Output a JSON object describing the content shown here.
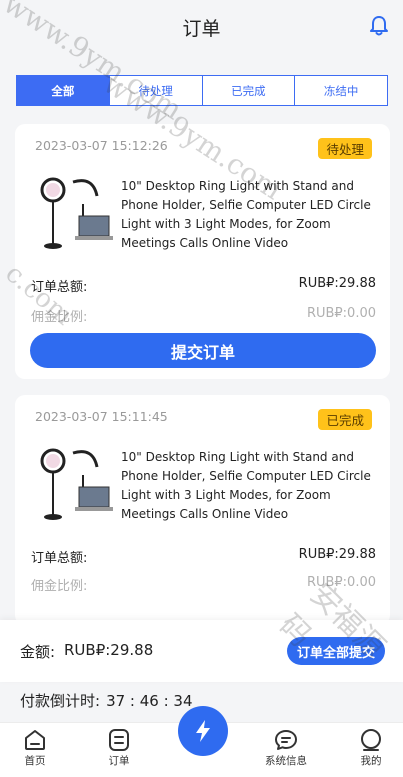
{
  "header": {
    "title": "订单",
    "bell_icon": "bell-icon"
  },
  "tabs": [
    {
      "label": "全部",
      "active": true
    },
    {
      "label": "待处理",
      "active": false
    },
    {
      "label": "已完成",
      "active": false
    },
    {
      "label": "冻结中",
      "active": false
    }
  ],
  "orders": [
    {
      "date": "2023-03-07 15:12:26",
      "status": "待处理",
      "product_name": "10\" Desktop Ring Light with Stand and Phone Holder, Selfie Computer LED Circle Light with 3 Light Modes, for Zoom Meetings Calls Online Video",
      "total_label": "订单总额:",
      "total_value": "RUB₽:29.88",
      "commission_label": "佣金比例:",
      "commission_value": "RUB₽:0.00",
      "submit_label": "提交订单"
    },
    {
      "date": "2023-03-07 15:11:45",
      "status": "已完成",
      "product_name": "10\" Desktop Ring Light with Stand and Phone Holder, Selfie Computer LED Circle Light with 3 Light Modes, for Zoom Meetings Calls Online Video",
      "total_label": "订单总额:",
      "total_value": "RUB₽:29.88",
      "commission_label": "佣金比例:",
      "commission_value": "RUB₽:0.00"
    }
  ],
  "summary": {
    "amount_label": "金额:",
    "amount_value": "RUB₽:29.88",
    "submit_all_label": "订单全部提交"
  },
  "countdown": {
    "label": "付款倒计时:",
    "value": "37 : 46 : 34"
  },
  "nav": {
    "home": "首页",
    "orders": "订单",
    "messages": "系统信息",
    "mine": "我的"
  },
  "watermark": {
    "text1": "www.9ym.com",
    "text2": "www.9ym.com",
    "text3": "c.com",
    "text4": "安福源码"
  },
  "colors": {
    "accent": "#2f6bf0",
    "badge": "#ffc21a",
    "tab_border": "#3d6cf3"
  }
}
